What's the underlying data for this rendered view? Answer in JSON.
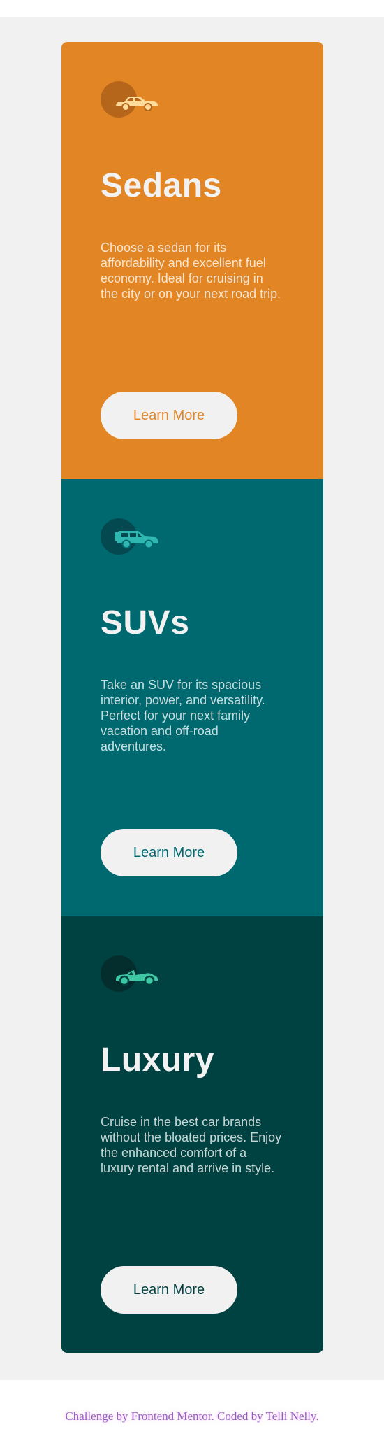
{
  "colors": {
    "page_background": "#f1f1f1",
    "sedans": "#e28625",
    "suvs": "#006970",
    "luxury": "#004241",
    "button_background": "#f1f1f1",
    "attribution_text": "#9b5ec9"
  },
  "cards": [
    {
      "icon": "sedan-car-icon",
      "title": "Sedans",
      "description": "Choose a sedan for its affordability and excellent fuel economy. Ideal for cruising in the city or on your next road trip.",
      "button_label": "Learn More"
    },
    {
      "icon": "suv-car-icon",
      "title": "SUVs",
      "description": "Take an SUV for its spacious interior, power, and versatility. Perfect for your next family vacation and off-road adventures.",
      "button_label": "Learn More"
    },
    {
      "icon": "luxury-car-icon",
      "title": "Luxury",
      "description": "Cruise in the best car brands without the bloated prices. Enjoy the enhanced comfort of a luxury rental and arrive in style.",
      "button_label": "Learn More"
    }
  ],
  "footer": {
    "attribution": "Challenge by Frontend Mentor. Coded by Telli Nelly."
  }
}
